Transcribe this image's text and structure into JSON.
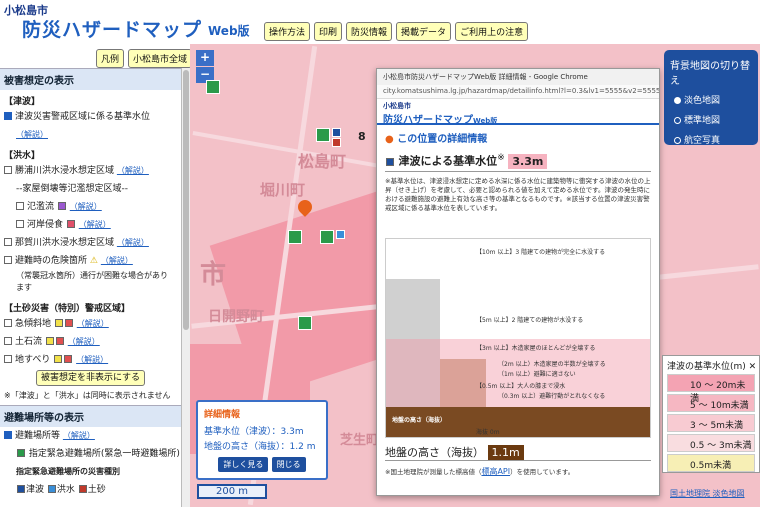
{
  "header": {
    "city": "小松島市",
    "title": "防災ハザードマップ",
    "subtitle": "Web版",
    "nav": [
      "操作方法",
      "印刷",
      "防災情報",
      "掲載データ",
      "ご利用上の注意"
    ]
  },
  "quick": [
    "凡例",
    "小松島市全域"
  ],
  "sidebar": {
    "sec1": "被害想定の表示",
    "tsunami_cat": "【津波】",
    "tsunami_item": "津波災害警戒区域に係る基準水位",
    "link": "（解説）",
    "flood_cat": "【洪水】",
    "flood1": "勝浦川洪水浸水想定区域",
    "house_head": "--家屋倒壊等氾濫想定区域--",
    "house1": "氾濫流",
    "house2": "河岸侵食",
    "flood2": "那賀川洪水浸水想定区域",
    "danger": "避難時の危険箇所",
    "danger_note1": "（常襲冠水箇所）通行が困難な場合があり",
    "danger_note2": "ます",
    "land_cat": "【土砂災害（特別）警戒区域】",
    "land1": "急傾斜地",
    "land2": "土石流",
    "land3": "地すべり",
    "hide_btn": "被害想定を非表示にする",
    "hide_note": "※「津波」と「洪水」は同時に表示されません",
    "sec2": "避難場所等の表示",
    "shelter_item": "避難場所等",
    "shelter_link": "（解説）",
    "shelter1": "指定緊急避難場所(緊急一時避難場所)",
    "shelter2": "指定緊急避難場所の災害種別",
    "shelter_kinds": [
      "津波",
      "洪水",
      "土砂"
    ]
  },
  "map": {
    "labels": [
      "松島町",
      "堀川町",
      "日開野町",
      "市",
      "芝生町"
    ],
    "num": "8",
    "zoom_in": "+",
    "zoom_out": "−",
    "scale": "200 m",
    "gsi": "国土地理院 淡色地図"
  },
  "basemap": {
    "title": "背景地図の切り替え",
    "options": [
      "淡色地図",
      "標準地図",
      "航空写真"
    ]
  },
  "popup": {
    "window_title": "小松島市防災ハザードマップWeb版 詳細情報 - Google Chrome",
    "url": "city.komatsushima.lg.jp/hazardmap/detailinfo.html?l=0.3&lv1=5555&v2=5555&v...",
    "city": "小松島市",
    "title": "防災ハザードマップ",
    "subtitle": "Web版",
    "detail_head": "この位置の詳細情報",
    "tsunami_label": "津波による基準水位",
    "sup": "※",
    "tsunami_value": "3.3m",
    "desc": "※基準水位は、津波浸水想定に定める水深に係る水位に建築物等に衝突する津波の水位の上昇（せき上げ）を考慮して、必要と認められる値を加えて定める水位です。津波の発生時における避難施設の避難上有効な高さ等の基準となるものです。※該当する位置の津波災害警戒区域に係る基準水位を表しています。",
    "levels": [
      "【10m 以上】3 階建ての建物が完全に水没する",
      "【5m 以上】2 階建ての建物が水没する",
      "【3m 以上】木造家屋のほとんどが全壊する",
      "（2m 以上）木造家屋の半数が全壊する",
      "（1m 以上）避難に適さない",
      "【0.5m 以上】大人の膝まで浸水",
      "（0.3m 以上）避難行動がとれなくなる"
    ],
    "ground_label": "地盤の高さ（海抜）",
    "ground_caption": "地盤の高さ（海抜）",
    "sea_level": "海抜 0m",
    "ground_value": "1.1m",
    "note_a": "※国土地理院が測量した標高値（",
    "note_link": "標高API",
    "note_b": "）を使用しています。"
  },
  "legend": {
    "title": "津波の基準水位(m)",
    "items": [
      "10 ～ 20m未満",
      "5 ～ 10m未満",
      "3 ～ 5m未満",
      "0.5 ～ 3m未満",
      "0.5m未満"
    ],
    "close": "✕"
  },
  "detailbox": {
    "title": "詳細情報",
    "row1_label": "基準水位（津波）",
    "row1_value": "：3.3m",
    "row2_label": "地盤の高さ（海抜）",
    "row2_value": "：1.2 m",
    "btn1": "詳しく見る",
    "btn2": "閉じる"
  },
  "colors": {
    "accent": "#1f5fbf",
    "deep_pink": "#f29aa8",
    "light_pink": "#f3c1c8",
    "legend": [
      "#f4a3b3",
      "#f6b7c2",
      "#f8cbd2",
      "#f9dde0",
      "#f7efb5"
    ]
  }
}
